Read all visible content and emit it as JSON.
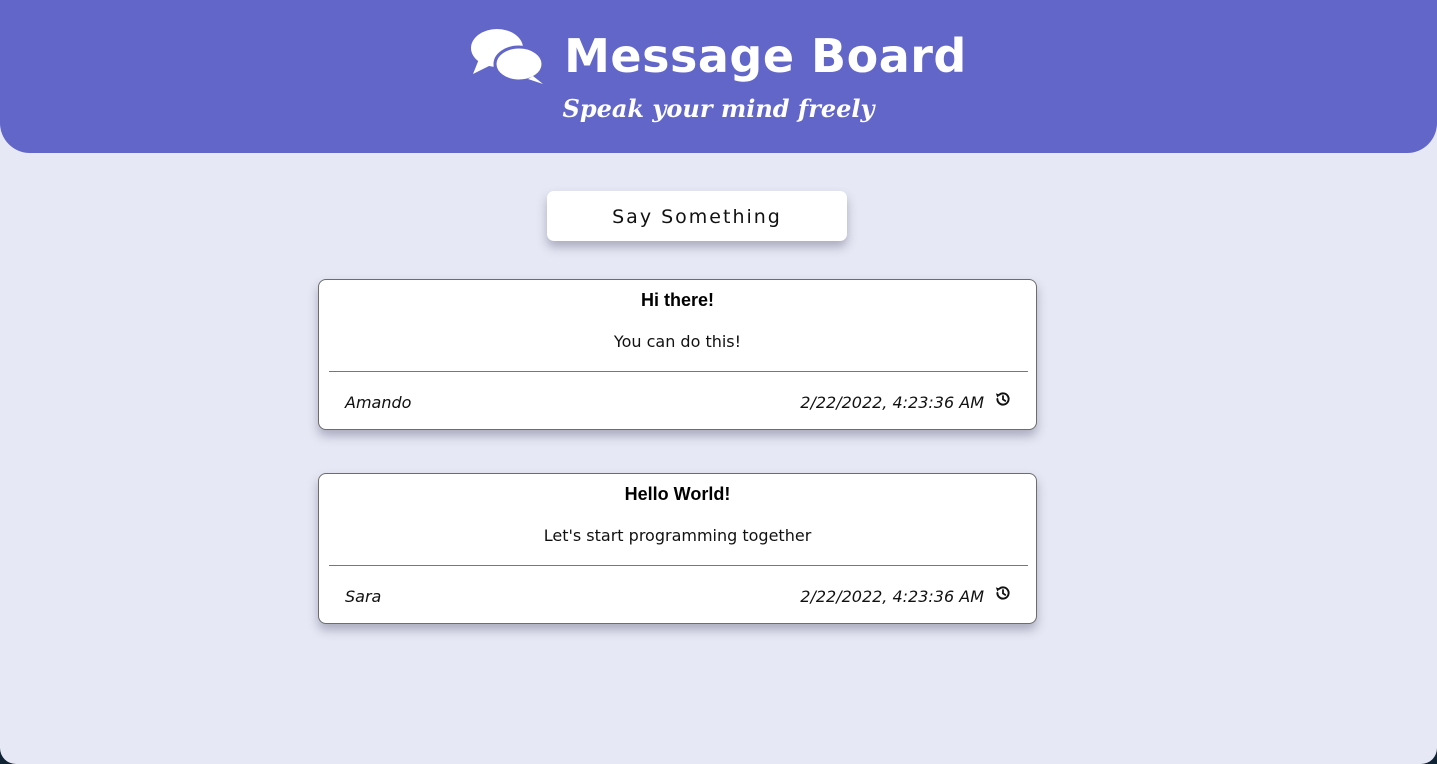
{
  "header": {
    "icon": "comments-icon",
    "title": "Message Board",
    "subtitle": "Speak your mind freely",
    "color": "#6166c8"
  },
  "actions": {
    "say_label": "Say Something"
  },
  "messages": [
    {
      "title": "Hi there!",
      "body": "You can do this!",
      "author": "Amando",
      "timestamp": "2/22/2022, 4:23:36 AM",
      "icon": "history-icon"
    },
    {
      "title": "Hello World!",
      "body": "Let's start programming together",
      "author": "Sara",
      "timestamp": "2/22/2022, 4:23:36 AM",
      "icon": "history-icon"
    }
  ],
  "colors": {
    "page_background": "#e6e8f5",
    "card_background": "#ffffff"
  }
}
